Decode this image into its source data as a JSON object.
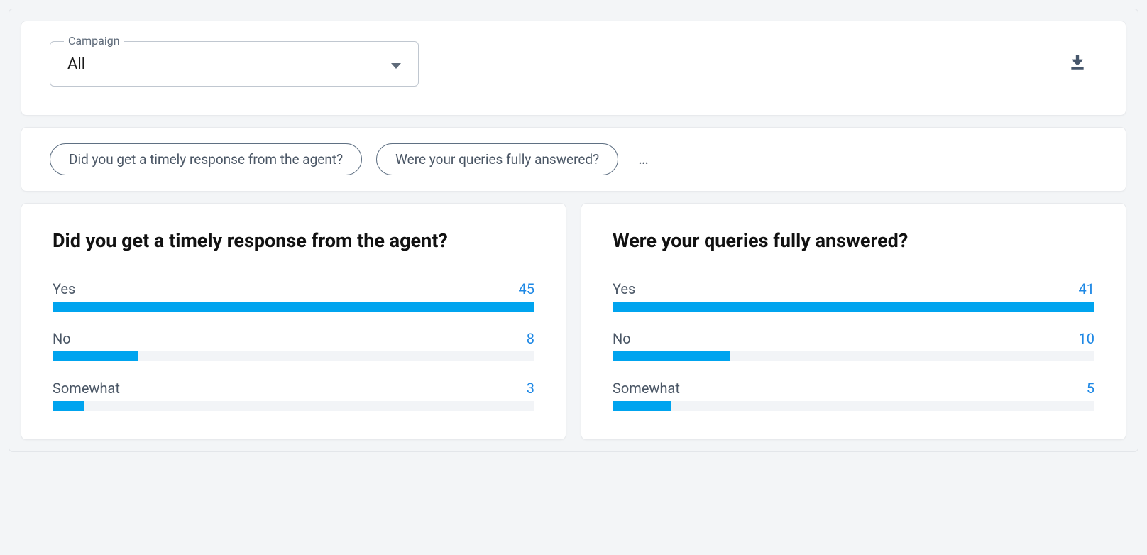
{
  "filter": {
    "label": "Campaign",
    "value": "All"
  },
  "chips": [
    "Did you get a timely response from the agent?",
    "Were your queries fully answered?"
  ],
  "chips_more": "…",
  "chart_data": [
    {
      "type": "bar",
      "title": "Did you get a timely response from the agent?",
      "categories": [
        "Yes",
        "No",
        "Somewhat"
      ],
      "values": [
        45,
        8,
        3
      ]
    },
    {
      "type": "bar",
      "title": "Were your queries fully answered?",
      "categories": [
        "Yes",
        "No",
        "Somewhat"
      ],
      "values": [
        41,
        10,
        5
      ]
    }
  ]
}
